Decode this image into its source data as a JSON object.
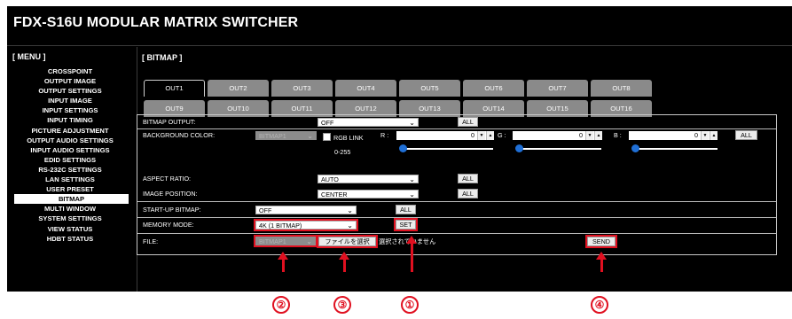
{
  "app": {
    "title": "FDX-S16U MODULAR MATRIX SWITCHER"
  },
  "menu": {
    "title": "[ MENU ]",
    "items": [
      "CROSSPOINT",
      "OUTPUT IMAGE",
      "OUTPUT SETTINGS",
      "INPUT IMAGE",
      "INPUT SETTINGS",
      "INPUT TIMING",
      "PICTURE ADJUSTMENT",
      "OUTPUT AUDIO SETTINGS",
      "INPUT AUDIO SETTINGS",
      "EDID SETTINGS",
      "RS-232C SETTINGS",
      "LAN SETTINGS",
      "USER PRESET",
      "BITMAP",
      "MULTI WINDOW",
      "SYSTEM SETTINGS",
      "VIEW STATUS",
      "HDBT STATUS"
    ],
    "active": "BITMAP"
  },
  "page": {
    "title": "[ BITMAP ]"
  },
  "tabs": {
    "row1": [
      "OUT1",
      "OUT2",
      "OUT3",
      "OUT4",
      "OUT5",
      "OUT6",
      "OUT7",
      "OUT8"
    ],
    "row2": [
      "OUT9",
      "OUT10",
      "OUT11",
      "OUT12",
      "OUT13",
      "OUT14",
      "OUT15",
      "OUT16"
    ],
    "active": "OUT1"
  },
  "form": {
    "bitmap_output": {
      "label": "BITMAP OUTPUT:",
      "value": "OFF",
      "all": "ALL"
    },
    "background_color": {
      "label": "BACKGROUND COLOR:",
      "bitmap_select": "BITMAP1",
      "rgb_link": "RGB LINK",
      "range": "0-255",
      "r_label": "R :",
      "r_value": "0",
      "g_label": "G :",
      "g_value": "0",
      "b_label": "B :",
      "b_value": "0",
      "all": "ALL",
      "spin_down": "▼",
      "spin_up": "▲"
    },
    "aspect_ratio": {
      "label": "ASPECT RATIO:",
      "value": "AUTO",
      "all": "ALL"
    },
    "image_position": {
      "label": "IMAGE POSITION:",
      "value": "CENTER",
      "all": "ALL"
    },
    "startup_bitmap": {
      "label": "START-UP BITMAP:",
      "value": "OFF",
      "all": "ALL"
    },
    "memory_mode": {
      "label": "MEMORY MODE:",
      "value": "4K (1 BITMAP)",
      "set": "SET"
    },
    "file": {
      "label": "FILE:",
      "bitmap_select": "BITMAP1",
      "choose_file": "ファイルを選択",
      "no_file": "選択されていません",
      "send": "SEND"
    }
  },
  "annotations": [
    "②",
    "③",
    "①",
    "④"
  ],
  "colors": {
    "highlight": "#e01020",
    "slider_knob": "#1f6fd6",
    "tab_inactive": "#8a8a8a"
  }
}
